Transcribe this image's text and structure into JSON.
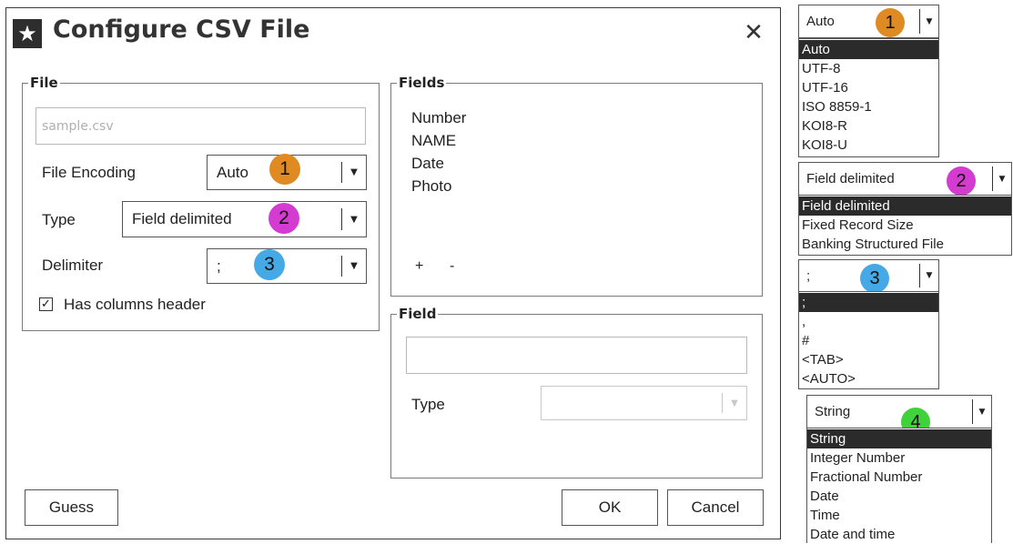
{
  "dialog": {
    "title": "Configure CSV File",
    "icon": "star-icon",
    "close_glyph": "✕"
  },
  "file_group": {
    "legend": "File",
    "filename_placeholder": "sample.csv",
    "encoding_label": "File Encoding",
    "encoding_value": "Auto",
    "type_label": "Type",
    "type_value": "Field delimited",
    "delimiter_label": "Delimiter",
    "delimiter_value": ";",
    "has_header_label": "Has columns header",
    "has_header_checked": true,
    "checkbox_glyph": "✓"
  },
  "fields_group": {
    "legend": "Fields",
    "items": [
      "Number",
      "NAME",
      "Date",
      "Photo"
    ],
    "add_label": "+",
    "remove_label": "-"
  },
  "field_group": {
    "legend": "Field",
    "name_value": "",
    "type_label": "Type",
    "type_value": ""
  },
  "buttons": {
    "guess": "Guess",
    "ok": "OK",
    "cancel": "Cancel"
  },
  "badges": {
    "one": "1",
    "two": "2",
    "three": "3",
    "four": "4",
    "colors": {
      "one": "#e08a24",
      "two": "#d43bd0",
      "three": "#45a9e6",
      "four": "#3fd23a"
    }
  },
  "dropdowns": {
    "encoding": {
      "value": "Auto",
      "options": [
        "Auto",
        "UTF-8",
        "UTF-16",
        "ISO 8859-1",
        "KOI8-R",
        "KOI8-U"
      ],
      "selected": 0
    },
    "type": {
      "value": "Field delimited",
      "options": [
        "Field delimited",
        "Fixed Record Size",
        "Banking Structured File"
      ],
      "selected": 0
    },
    "delimiter": {
      "value": ";",
      "options": [
        ";",
        ",",
        "#",
        "<TAB>",
        "<AUTO>"
      ],
      "selected": 0
    },
    "field_type": {
      "value": "String",
      "options": [
        "String",
        "Integer Number",
        "Fractional Number",
        "Date",
        "Time",
        "Date and time"
      ],
      "selected": 0
    }
  },
  "arrow_glyph": "▼"
}
